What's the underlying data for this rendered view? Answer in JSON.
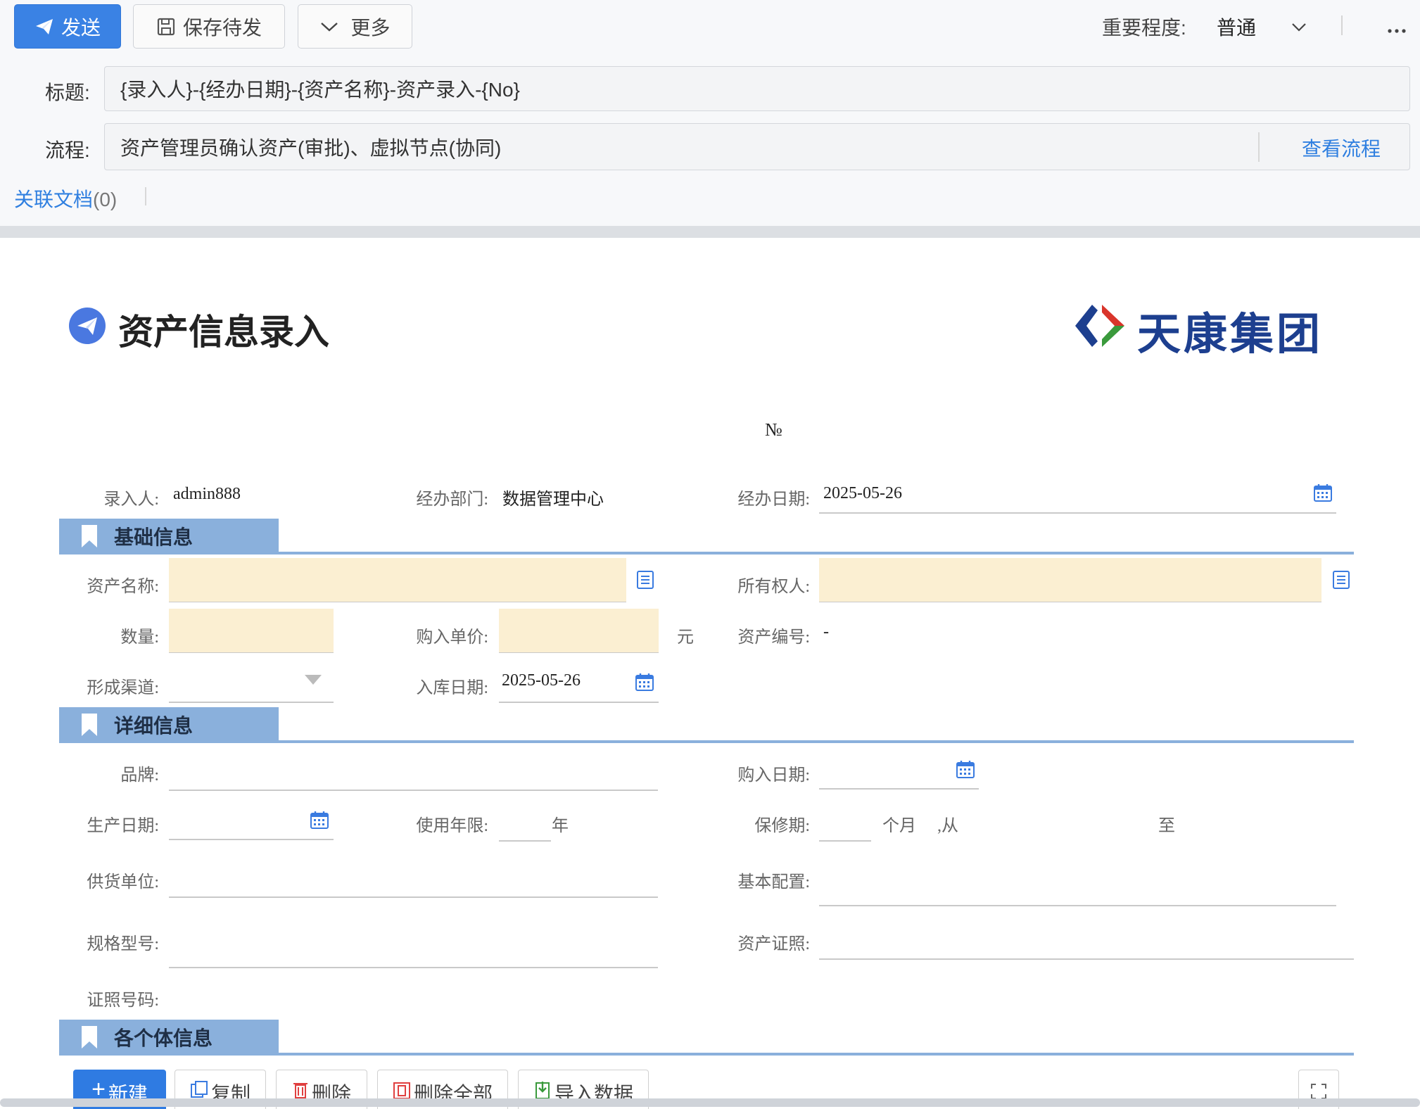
{
  "toolbar": {
    "send_label": "发送",
    "save_label": "保存待发",
    "more_label": "更多",
    "priority_label": "重要程度:",
    "priority_value": "普通"
  },
  "header": {
    "title_label": "标题:",
    "title_value": "{录入人}-{经办日期}-{资产名称}-资产录入-{No}",
    "flow_label": "流程:",
    "flow_value": "资产管理员确认资产(审批)、虚拟节点(协同)",
    "view_flow_link": "查看流程",
    "related_docs_link": "关联文档",
    "related_docs_count": "(0)"
  },
  "form": {
    "title": "资产信息录入",
    "logo_text": "天康集团",
    "number_sign": "№",
    "top": {
      "entrant_label": "录入人:",
      "entrant_value": "admin888",
      "dept_label": "经办部门:",
      "dept_value": "数据管理中心",
      "date_label": "经办日期:",
      "date_value": "2025-05-26"
    },
    "basic": {
      "section_title": "基础信息",
      "asset_name_label": "资产名称:",
      "owner_label": "所有权人:",
      "quantity_label": "数量:",
      "unit_price_label": "购入单价:",
      "unit_price_unit": "元",
      "asset_no_label": "资产编号:",
      "asset_no_value": "-",
      "channel_label": "形成渠道:",
      "stock_date_label": "入库日期:",
      "stock_date_value": "2025-05-26"
    },
    "detail": {
      "section_title": "详细信息",
      "brand_label": "品牌:",
      "purchase_date_label": "购入日期:",
      "production_date_label": "生产日期:",
      "service_life_label": "使用年限:",
      "service_life_unit": "年",
      "warranty_label": "保修期:",
      "warranty_unit": "个月",
      "warranty_from": ",从",
      "warranty_to": "至",
      "supplier_label": "供货单位:",
      "config_label": "基本配置:",
      "model_label": "规格型号:",
      "certificate_label": "资产证照:",
      "cert_no_label": "证照号码:"
    },
    "individual": {
      "section_title": "各个体信息",
      "new_label": "新建",
      "copy_label": "复制",
      "delete_label": "删除",
      "delete_all_label": "删除全部",
      "import_label": "导入数据"
    }
  },
  "colors": {
    "primary": "#3a82e4",
    "section": "#8ab0dc",
    "required_field": "#fbefd2",
    "link": "#2f7fe0"
  }
}
